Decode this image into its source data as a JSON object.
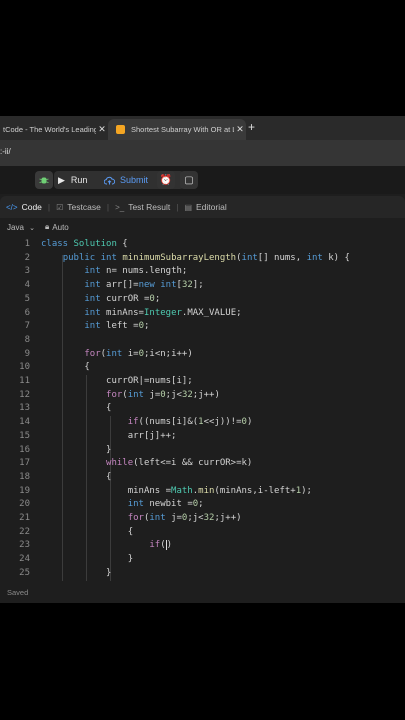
{
  "browser": {
    "tabs": [
      {
        "title": "tCode - The World's Leading",
        "active": false
      },
      {
        "title": "Shortest Subarray With OR at L",
        "active": true
      }
    ],
    "url": ":-ii/"
  },
  "toolbar": {
    "run_label": "Run",
    "submit_label": "Submit"
  },
  "panel": {
    "tabs": [
      {
        "label": "Code",
        "active": true,
        "icon": "code-icon"
      },
      {
        "label": "Testcase",
        "active": false,
        "icon": "checkbox-icon"
      },
      {
        "label": "Test Result",
        "active": false,
        "icon": "terminal-icon"
      },
      {
        "label": "Editorial",
        "active": false,
        "icon": "book-icon"
      }
    ],
    "language": "Java",
    "autocomplete": "Auto"
  },
  "code_lines": [
    "class Solution {",
    "    public int minimumSubarrayLength(int[] nums, int k) {",
    "        int n= nums.length;",
    "        int arr[]=new int[32];",
    "        int currOR =0;",
    "        int minAns=Integer.MAX_VALUE;",
    "        int left =0;",
    "",
    "        for(int i=0;i<n;i++)",
    "        {",
    "            currOR|=nums[i];",
    "            for(int j=0;j<32;j++)",
    "            {",
    "                if((nums[i]&(1<<j))!=0)",
    "                arr[j]++;",
    "            }",
    "            while(left<=i && currOR>=k)",
    "            {",
    "                minAns =Math.min(minAns,i-left+1);",
    "                int newbit =0;",
    "                for(int j=0;j<32;j++)",
    "                {",
    "                    if()",
    "                }",
    "            }"
  ],
  "status": "Saved"
}
